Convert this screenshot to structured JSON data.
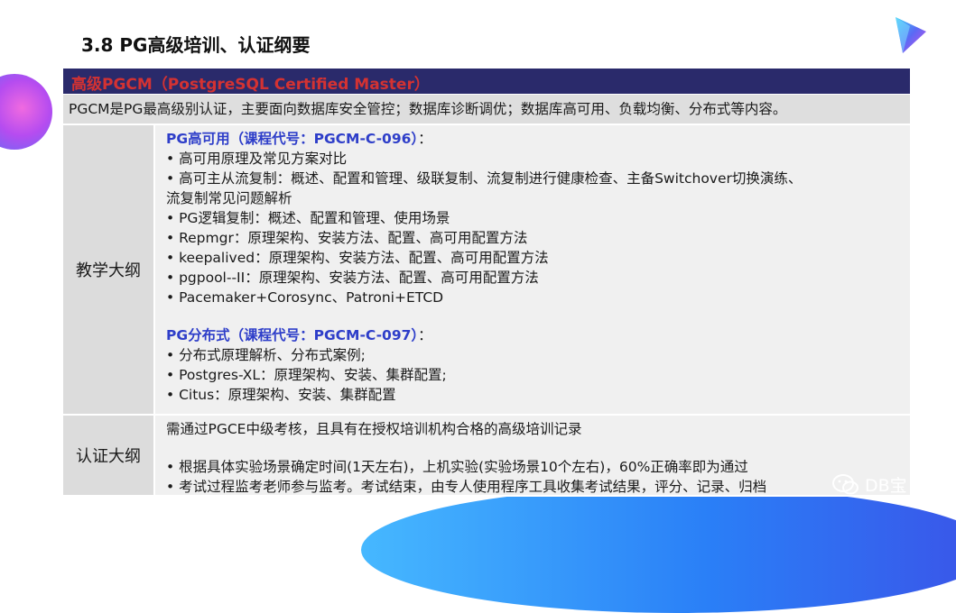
{
  "title": "3.8  PG高级培训、认证纲要",
  "header": "高级PGCM（PostgreSQL Certified Master）",
  "summary": "PGCM是PG最高级别认证，主要面向数据库安全管控；数据库诊断调优；数据库高可用、负载均衡、分布式等内容。",
  "syllabus": {
    "label": "教学大纲",
    "course1": {
      "heading": "PG高可用（课程代号：PGCM-C-096）",
      "tail": "：",
      "items": [
        "• 高可用原理及常见方案对比",
        "• 高可主从流复制：概述、配置和管理、级联复制、流复制进行健康检查、主备Switchover切换演练、",
        "流复制常见问题解析",
        "• PG逻辑复制：概述、配置和管理、使用场景",
        "• Repmgr：原理架构、安装方法、配置、高可用配置方法",
        "• keepalived：原理架构、安装方法、配置、高可用配置方法",
        "• pgpool--II：原理架构、安装方法、配置、高可用配置方法",
        "• Pacemaker+Corosync、Patroni+ETCD"
      ]
    },
    "course2": {
      "heading": "PG分布式（课程代号：PGCM-C-097）",
      "tail": "：",
      "items": [
        "• 分布式原理解析、分布式案例;",
        "• Postgres-XL：原理架构、安装、集群配置;",
        "• Citus：原理架构、安装、集群配置"
      ]
    }
  },
  "certification": {
    "label": "认证大纲",
    "line1": "需通过PGCE中级考核，且具有在授权培训机构合格的高级培训记录",
    "items": [
      "• 根据具体实验场景确定时间(1天左右)，上机实验(实验场景10个左右)，60%正确率即为通过",
      "• 考试过程监考老师参与监考。考试结束，由专人使用程序工具收集考试结果，评分、记录、归档"
    ]
  },
  "watermark": "DB宝",
  "colors": {
    "header_bg": "#2a2a6b",
    "header_text": "#d43232",
    "course_heading": "#2e3ec9"
  }
}
